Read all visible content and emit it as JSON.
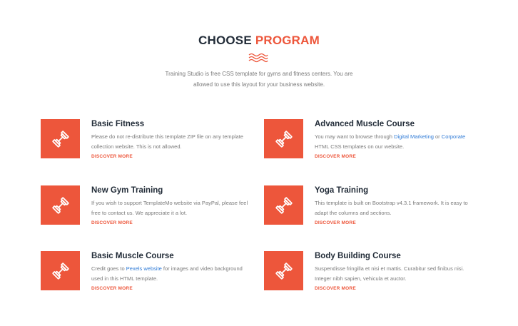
{
  "section": {
    "heading_dark": "CHOOSE",
    "heading_accent": "PROGRAM",
    "intro_line1": "Training Studio is free CSS template for gyms and fitness centers. You are",
    "intro_line2": "allowed to use this layout for your business website.",
    "icon": "dumbbell-icon",
    "divider_icon": "waves-icon"
  },
  "colors": {
    "accent": "#ed563b",
    "heading": "#232d39",
    "text": "#7a7a7a",
    "link": "#2e7ad6"
  },
  "programs": [
    {
      "title": "Basic Fitness",
      "desc": "Please do not re-distribute this template ZIP file on any template collection website. This is not allowed.",
      "more": "DISCOVER MORE"
    },
    {
      "title": "Advanced Muscle Course",
      "desc_pre": "You may want to browse through",
      "link1": "Digital Marketing",
      "desc_mid": "or",
      "link2": "Corporate",
      "desc_post": "HTML CSS templates on our website.",
      "more": "DISCOVER MORE"
    },
    {
      "title": "New Gym Training",
      "desc": "If you wish to support TemplateMo website via PayPal, please feel free to contact us. We appreciate it a lot.",
      "more": "DISCOVER MORE"
    },
    {
      "title": "Yoga Training",
      "desc": "This template is built on Bootstrap v4.3.1 framework. It is easy to adapt the columns and sections.",
      "more": "DISCOVER MORE"
    },
    {
      "title": "Basic Muscle Course",
      "desc_pre": "Credit goes to",
      "link1": "Pexels website",
      "desc_post": "for images and video background used in this HTML template.",
      "more": "DISCOVER MORE"
    },
    {
      "title": "Body Building Course",
      "desc": "Suspendisse fringilla et nisi et mattis. Curabitur sed finibus nisi. Integer nibh sapien, vehicula et auctor.",
      "more": "DISCOVER MORE"
    }
  ]
}
